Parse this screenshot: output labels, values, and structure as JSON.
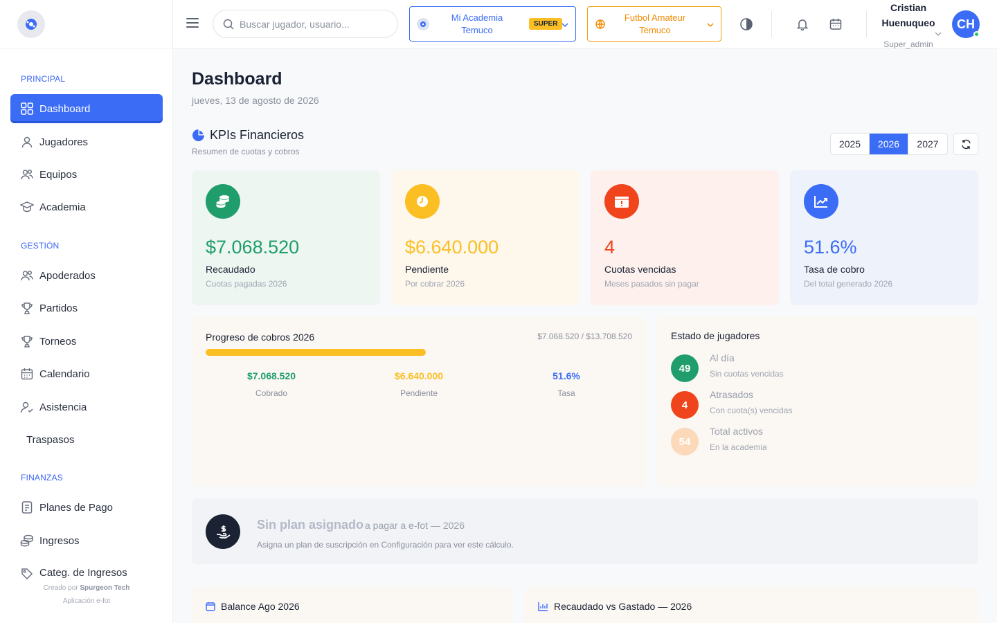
{
  "sidebar": {
    "sections": {
      "principal": "PRINCIPAL",
      "gestion": "GESTIÓN",
      "finanzas": "FINANZAS"
    },
    "items": {
      "dashboard": "Dashboard",
      "jugadores": "Jugadores",
      "equipos": "Equipos",
      "academia": "Academia",
      "apoderados": "Apoderados",
      "partidos": "Partidos",
      "torneos": "Torneos",
      "calendario": "Calendario",
      "asistencia": "Asistencia",
      "traspasos": "Traspasos",
      "planes": "Planes de Pago",
      "ingresos": "Ingresos",
      "categ": "Categ. de Ingresos"
    },
    "footer_prefix": "Creado por",
    "footer_brand": "Spurgeon Tech",
    "footer_app": "Aplicación e-fot"
  },
  "header": {
    "search_placeholder": "Buscar jugador, usuario...",
    "academy_line1": "Mi Academia",
    "academy_line2": "Temuco",
    "academy_badge": "SUPER",
    "club_line1": "Futbol Amateur",
    "club_line2": "Temuco",
    "user_first": "Cristian",
    "user_last": "Huenuqueo",
    "user_role": "Super_admin",
    "avatar_initials": "CH"
  },
  "page": {
    "title": "Dashboard",
    "date": "jueves, 13 de agosto de 2026"
  },
  "kpi": {
    "title": "KPIs Financieros",
    "subtitle": "Resumen de cuotas y cobros",
    "years": [
      "2025",
      "2026",
      "2027"
    ],
    "active_year": "2026",
    "cards": [
      {
        "value": "$7.068.520",
        "label": "Recaudado",
        "desc": "Cuotas pagadas 2026",
        "color": "#1f9d6b",
        "bg": "#eef6f2",
        "icon": "coins-icon"
      },
      {
        "value": "$6.640.000",
        "label": "Pendiente",
        "desc": "Por cobrar 2026",
        "color": "#fbbf24",
        "bg": "#fdf7ec",
        "icon": "clock-icon"
      },
      {
        "value": "4",
        "label": "Cuotas vencidas",
        "desc": "Meses pasados sin pagar",
        "color": "#f0441c",
        "bg": "#fdf0ed",
        "icon": "calendar-alert-icon"
      },
      {
        "value": "51.6%",
        "label": "Tasa de cobro",
        "desc": "Del total generado 2026",
        "color": "#3b6cf6",
        "bg": "#eef2fb",
        "icon": "trend-up-icon"
      }
    ]
  },
  "progress": {
    "title": "Progreso de cobros 2026",
    "ratio": "$7.068.520 / $13.708.520",
    "fraction": 0.516,
    "stats": [
      {
        "value": "$7.068.520",
        "label": "Cobrado",
        "color": "#1f9d6b"
      },
      {
        "value": "$6.640.000",
        "label": "Pendiente",
        "color": "#fbbf24"
      },
      {
        "value": "51.6%",
        "label": "Tasa",
        "color": "#3b6cf6"
      }
    ]
  },
  "estado": {
    "title": "Estado de jugadores",
    "rows": [
      {
        "count": "49",
        "label": "Al día",
        "desc": "Sin cuotas vencidas",
        "color": "#1f9d6b"
      },
      {
        "count": "4",
        "label": "Atrasados",
        "desc": "Con cuota(s) vencidas",
        "color": "#f0441c"
      },
      {
        "count": "54",
        "label": "Total activos",
        "desc": "En la academia",
        "color": "#fcd9b8"
      }
    ]
  },
  "plan": {
    "title": "Sin plan asignado",
    "title_suffix": "a pagar a e-fot — 2026",
    "desc": "Asigna un plan de suscripción en Configuración para ver este cálculo."
  },
  "bottom": {
    "balance_title": "Balance Ago 2026",
    "chart_title": "Recaudado vs Gastado — 2026"
  }
}
